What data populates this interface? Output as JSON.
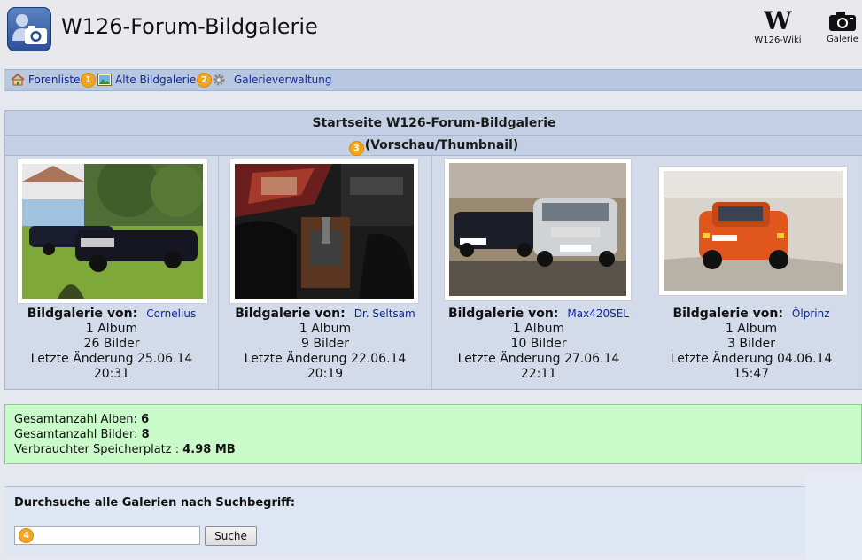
{
  "header": {
    "title": "W126-Forum-Bildgalerie",
    "wiki_label": "W126-Wiki",
    "wiki_glyph": "W",
    "gallery_label": "Galerie"
  },
  "nav": {
    "forenliste": "Forenliste",
    "alte_bildgalerie": "Alte Bildgalerie",
    "galerieverwaltung": "Galerieverwaltung"
  },
  "markers": [
    "1",
    "2",
    "3",
    "4"
  ],
  "panel": {
    "title": "Startseite W126-Forum-Bildgalerie",
    "subtitle": "(Vorschau/Thumbnail)"
  },
  "galleries": [
    {
      "label": "Bildgalerie von:",
      "owner": "Cornelius",
      "albums": "1 Album",
      "images": "26 Bilder",
      "changed": "Letzte Änderung 25.06.14",
      "time": "20:31"
    },
    {
      "label": "Bildgalerie von:",
      "owner": "Dr. Seltsam",
      "albums": "1 Album",
      "images": "9 Bilder",
      "changed": "Letzte Änderung 22.06.14",
      "time": "20:19"
    },
    {
      "label": "Bildgalerie von:",
      "owner": "Max420SEL",
      "albums": "1 Album",
      "images": "10 Bilder",
      "changed": "Letzte Änderung 27.06.14",
      "time": "22:11"
    },
    {
      "label": "Bildgalerie von:",
      "owner": "Ölprinz",
      "albums": "1 Album",
      "images": "3 Bilder",
      "changed": "Letzte Änderung 04.06.14",
      "time": "15:47"
    }
  ],
  "stats": {
    "albums_label": "Gesamtanzahl Alben:",
    "albums_value": "6",
    "images_label": "Gesamtanzahl Bilder:",
    "images_value": "8",
    "storage_label": "Verbrauchter Speicherplatz :",
    "storage_value": "4.98 MB"
  },
  "search": {
    "title": "Durchsuche alle Galerien nach Suchbegriff:",
    "input_value": "",
    "button_label": "Suche"
  },
  "colors": {
    "link": "#10269a",
    "nav_bg": "#b8c8e0",
    "panel_bg": "#cfd8ea",
    "stats_bg": "#c9fac9",
    "marker": "#f3a51c"
  }
}
